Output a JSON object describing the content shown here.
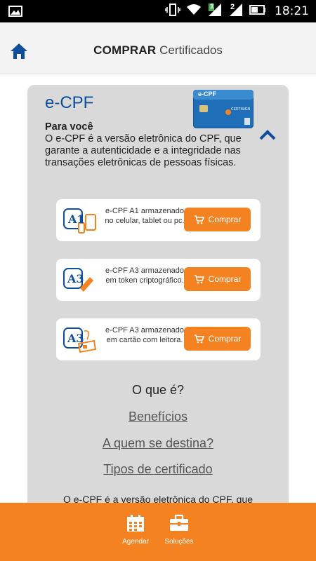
{
  "status_bar": {
    "time": "18:21",
    "sim1": "1",
    "sim2": "2"
  },
  "header": {
    "title_bold": "COMPRAR",
    "title_rest": "Certificados"
  },
  "card": {
    "title": "e-CPF",
    "intro_heading": "Para você",
    "intro_text": "O e-CPF é a versão eletrônica do CPF, que garante a autenticidade e a integridade nas transações eletrônicas de pessoas físicas.",
    "card_image": {
      "brand": "e-CPF",
      "issuer": "CERTISIGN"
    },
    "products": [
      {
        "badge": "A1",
        "description": "e-CPF A1 armazenado no celular, tablet ou pc.",
        "button": "Comprar"
      },
      {
        "badge": "A3",
        "description": "e-CPF A3 armazenado em token criptográfico.",
        "button": "Comprar"
      },
      {
        "badge": "A3",
        "description": "e-CPF A3 armazenado em cartão com leitora.",
        "button": "Comprar"
      }
    ],
    "section_heading": "O que é?",
    "links": [
      "Benefícios",
      "A quem se destina?",
      "Tipos de certificado"
    ],
    "paragraph_preview": "O e-CPF é a versão eletrônica do CPF, que"
  },
  "bottom_nav": {
    "items": [
      {
        "label": "Agendar",
        "icon": "calendar-icon"
      },
      {
        "label": "Soluções",
        "icon": "briefcase-icon"
      }
    ]
  },
  "colors": {
    "accent_orange": "#f58220",
    "brand_blue": "#0e4e9a",
    "card_bg": "#d9d9d9"
  }
}
